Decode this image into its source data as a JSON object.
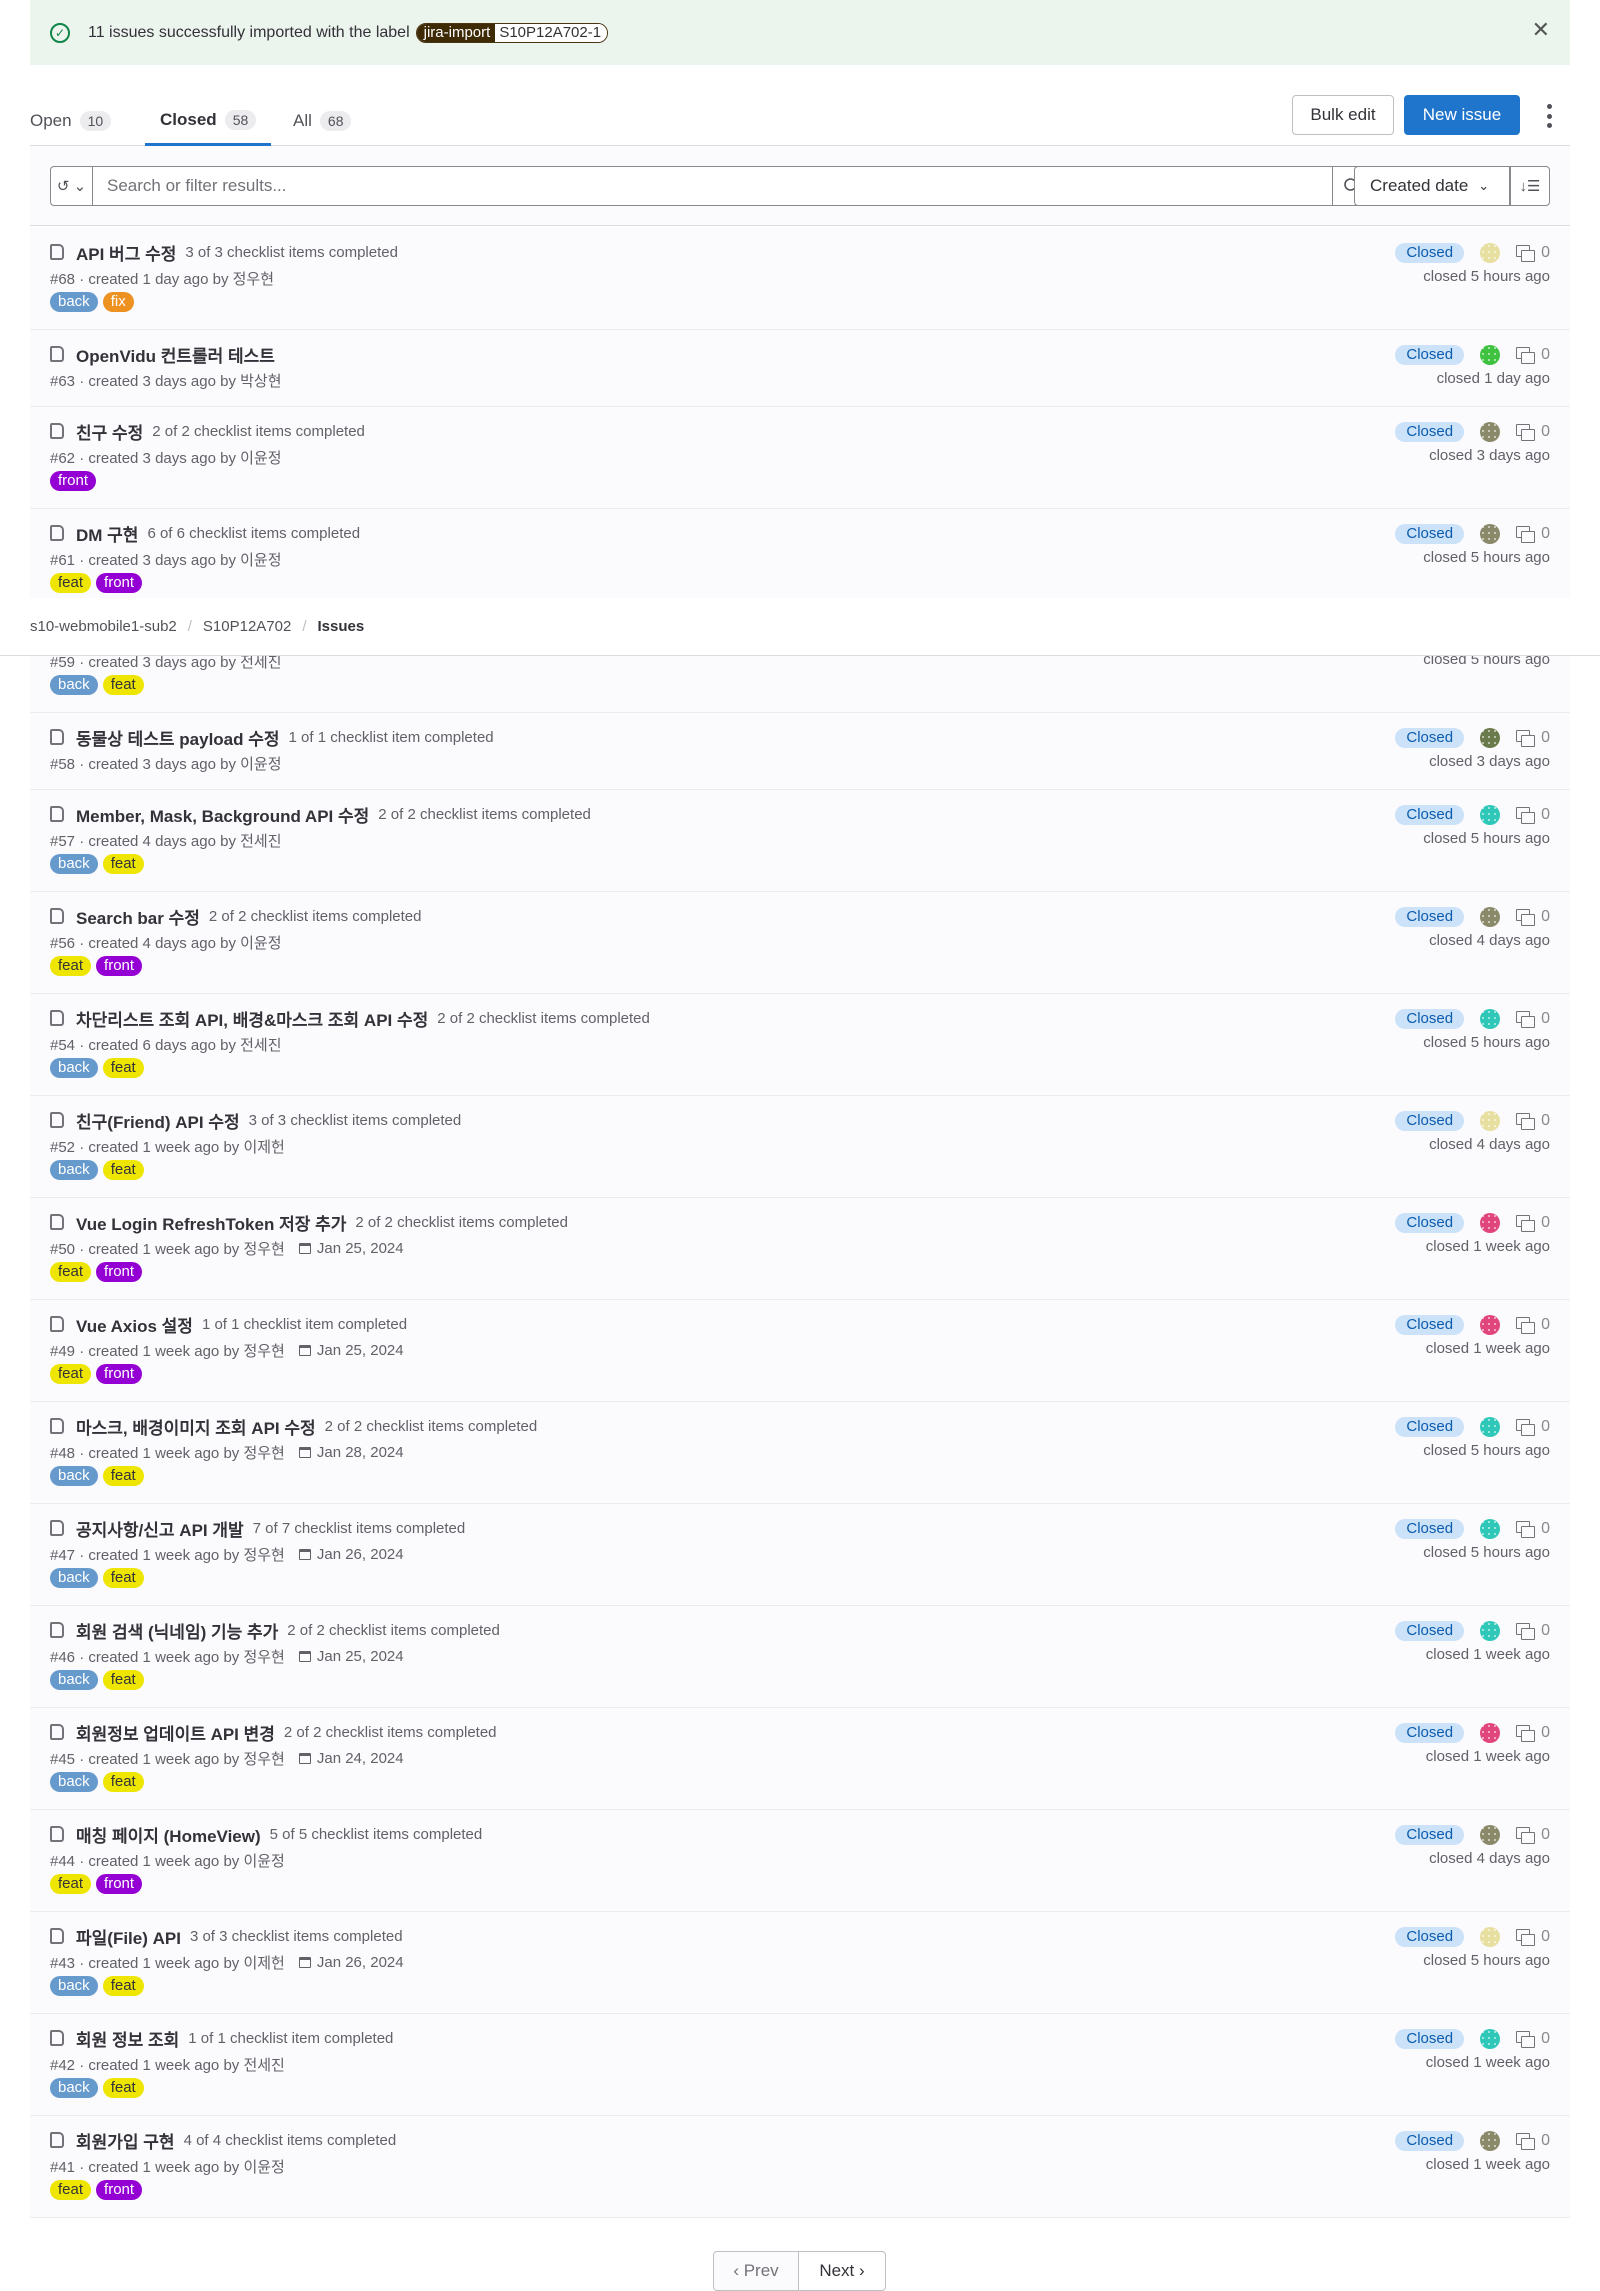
{
  "banner": {
    "message": "11 issues successfully imported with the label",
    "label_key": "jira-import",
    "label_value": "S10P12A702-1",
    "icon": "check-circle-icon"
  },
  "tabs": [
    {
      "label": "Open",
      "count": "10"
    },
    {
      "label": "Closed",
      "count": "58",
      "active": true
    },
    {
      "label": "All",
      "count": "68"
    }
  ],
  "actions": {
    "bulk_edit": "Bulk edit",
    "new_issue": "New issue"
  },
  "filter": {
    "placeholder": "Search or filter results...",
    "sort": "Created date"
  },
  "breadcrumb": [
    "s10-webmobile1-sub2",
    "S10P12A702",
    "Issues"
  ],
  "label_colors": {
    "back": {
      "bg": "#6699cc",
      "fg": "#ffffff"
    },
    "fix": {
      "bg": "#ed9121",
      "fg": "#ffffff"
    },
    "feat": {
      "bg": "#eee600",
      "fg": "#333238"
    },
    "front": {
      "bg": "#9400d3",
      "fg": "#ffffff"
    }
  },
  "issues": [
    {
      "title": "API 버그 수정",
      "checklist": "3 of 3 checklist items completed",
      "meta": "#68 · created 1 day ago by 정우현",
      "labels": [
        "back",
        "fix"
      ],
      "status": "Closed",
      "avatar": "#e6dfa0",
      "comments": "0",
      "closed": "closed 5 hours ago"
    },
    {
      "title": "OpenVidu 컨트롤러 테스트",
      "checklist": "",
      "meta": "#63 · created 3 days ago by 박상현",
      "labels": [],
      "status": "Closed",
      "avatar": "#3fc23f",
      "comments": "0",
      "closed": "closed 1 day ago"
    },
    {
      "title": "친구 수정",
      "checklist": "2 of 2 checklist items completed",
      "meta": "#62 · created 3 days ago by 이윤정",
      "labels": [
        "front"
      ],
      "status": "Closed",
      "avatar": "#8a8a6a",
      "comments": "0",
      "closed": "closed 3 days ago"
    },
    {
      "title": "DM 구현",
      "checklist": "6 of 6 checklist items completed",
      "meta": "#61 · created 3 days ago by 이윤정",
      "labels": [
        "feat",
        "front"
      ],
      "status": "Closed",
      "avatar": "#8a8a6a",
      "comments": "0",
      "closed": "closed 5 hours ago"
    },
    {
      "title": "",
      "checklist": "",
      "meta": "#59 · created 3 days ago by 전세진",
      "labels": [
        "back",
        "feat"
      ],
      "status": "Closed",
      "avatar": "#2fc8b8",
      "comments": "0",
      "closed": "closed 5 hours ago"
    },
    {
      "title": "동물상 테스트 payload 수정",
      "checklist": "1 of 1 checklist item completed",
      "meta": "#58 · created 3 days ago by 이윤정",
      "labels": [],
      "status": "Closed",
      "avatar": "#6b7a4a",
      "comments": "0",
      "closed": "closed 3 days ago"
    },
    {
      "title": "Member, Mask, Background API 수정",
      "checklist": "2 of 2 checklist items completed",
      "meta": "#57 · created 4 days ago by 전세진",
      "labels": [
        "back",
        "feat"
      ],
      "status": "Closed",
      "avatar": "#2fc8b8",
      "comments": "0",
      "closed": "closed 5 hours ago"
    },
    {
      "title": "Search bar 수정",
      "checklist": "2 of 2 checklist items completed",
      "meta": "#56 · created 4 days ago by 이윤정",
      "labels": [
        "feat",
        "front"
      ],
      "status": "Closed",
      "avatar": "#8a8a6a",
      "comments": "0",
      "closed": "closed 4 days ago"
    },
    {
      "title": "차단리스트 조회 API, 배경&마스크 조회 API 수정",
      "checklist": "2 of 2 checklist items completed",
      "meta": "#54 · created 6 days ago by 전세진",
      "labels": [
        "back",
        "feat"
      ],
      "status": "Closed",
      "avatar": "#2fc8b8",
      "comments": "0",
      "closed": "closed 5 hours ago"
    },
    {
      "title": "친구(Friend) API 수정",
      "checklist": "3 of 3 checklist items completed",
      "meta": "#52 · created 1 week ago by 이제헌",
      "labels": [
        "back",
        "feat"
      ],
      "status": "Closed",
      "avatar": "#e6dfa0",
      "comments": "0",
      "closed": "closed 4 days ago"
    },
    {
      "title": "Vue Login RefreshToken 저장 추가",
      "checklist": "2 of 2 checklist items completed",
      "meta": "#50 · created 1 week ago by 정우현",
      "due": "Jan 25, 2024",
      "labels": [
        "feat",
        "front"
      ],
      "status": "Closed",
      "avatar": "#e0457b",
      "comments": "0",
      "closed": "closed 1 week ago"
    },
    {
      "title": "Vue Axios 설정",
      "checklist": "1 of 1 checklist item completed",
      "meta": "#49 · created 1 week ago by 정우현",
      "due": "Jan 25, 2024",
      "labels": [
        "feat",
        "front"
      ],
      "status": "Closed",
      "avatar": "#e0457b",
      "comments": "0",
      "closed": "closed 1 week ago"
    },
    {
      "title": "마스크, 배경이미지 조회 API 수정",
      "checklist": "2 of 2 checklist items completed",
      "meta": "#48 · created 1 week ago by 정우현",
      "due": "Jan 28, 2024",
      "labels": [
        "back",
        "feat"
      ],
      "status": "Closed",
      "avatar": "#2fc8b8",
      "comments": "0",
      "closed": "closed 5 hours ago"
    },
    {
      "title": "공지사항/신고 API 개발",
      "checklist": "7 of 7 checklist items completed",
      "meta": "#47 · created 1 week ago by 정우현",
      "due": "Jan 26, 2024",
      "labels": [
        "back",
        "feat"
      ],
      "status": "Closed",
      "avatar": "#2fc8b8",
      "comments": "0",
      "closed": "closed 5 hours ago"
    },
    {
      "title": "회원 검색 (닉네임) 기능 추가",
      "checklist": "2 of 2 checklist items completed",
      "meta": "#46 · created 1 week ago by 정우현",
      "due": "Jan 25, 2024",
      "labels": [
        "back",
        "feat"
      ],
      "status": "Closed",
      "avatar": "#2fc8b8",
      "comments": "0",
      "closed": "closed 1 week ago"
    },
    {
      "title": "회원정보 업데이트 API 변경",
      "checklist": "2 of 2 checklist items completed",
      "meta": "#45 · created 1 week ago by 정우현",
      "due": "Jan 24, 2024",
      "labels": [
        "back",
        "feat"
      ],
      "status": "Closed",
      "avatar": "#e0457b",
      "comments": "0",
      "closed": "closed 1 week ago"
    },
    {
      "title": "매칭 페이지 (HomeView)",
      "checklist": "5 of 5 checklist items completed",
      "meta": "#44 · created 1 week ago by 이윤정",
      "labels": [
        "feat",
        "front"
      ],
      "status": "Closed",
      "avatar": "#8a8a6a",
      "comments": "0",
      "closed": "closed 4 days ago"
    },
    {
      "title": "파일(File) API",
      "checklist": "3 of 3 checklist items completed",
      "meta": "#43 · created 1 week ago by 이제헌",
      "due": "Jan 26, 2024",
      "labels": [
        "back",
        "feat"
      ],
      "status": "Closed",
      "avatar": "#e6dfa0",
      "comments": "0",
      "closed": "closed 5 hours ago"
    },
    {
      "title": "회원 정보 조회",
      "checklist": "1 of 1 checklist item completed",
      "meta": "#42 · created 1 week ago by 전세진",
      "labels": [
        "back",
        "feat"
      ],
      "status": "Closed",
      "avatar": "#2fc8b8",
      "comments": "0",
      "closed": "closed 1 week ago"
    },
    {
      "title": "회원가입 구현",
      "checklist": "4 of 4 checklist items completed",
      "meta": "#41 · created 1 week ago by 이윤정",
      "labels": [
        "feat",
        "front"
      ],
      "status": "Closed",
      "avatar": "#8a8a6a",
      "comments": "0",
      "closed": "closed 1 week ago"
    }
  ],
  "pagination": {
    "prev": "‹ Prev",
    "next": "Next ›"
  }
}
